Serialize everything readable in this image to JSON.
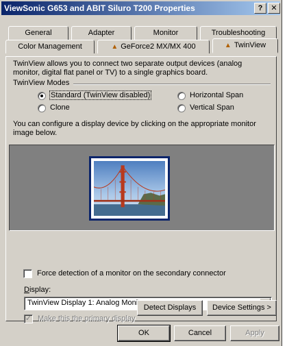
{
  "window": {
    "title": "ViewSonic G653 and ABIT Siluro T200 Properties",
    "help_btn": "?",
    "close_btn": "✕"
  },
  "tabs": {
    "row1": [
      "General",
      "Adapter",
      "Monitor",
      "Troubleshooting"
    ],
    "row2": [
      "Color Management",
      "GeForce2 MX/MX 400",
      "TwinView"
    ],
    "active": "TwinView"
  },
  "twinview": {
    "intro": "TwinView allows you to connect two separate output devices (analog monitor, digital flat panel or TV) to a single graphics board.",
    "modes_label": "TwinView Modes",
    "modes": [
      {
        "label": "Standard (TwinView disabled)",
        "checked": true
      },
      {
        "label": "Horizontal Span",
        "checked": false
      },
      {
        "label": "Clone",
        "checked": false
      },
      {
        "label": "Vertical Span",
        "checked": false
      }
    ],
    "configure_text": "You can configure a display device by clicking on the appropriate monitor image below.",
    "display_label": "Display:",
    "display_value": "TwinView Display 1: Analog Monitor",
    "primary_checkbox": "Make this the primary display",
    "force_checkbox": "Force detection of a monitor on the secondary connector",
    "detect_btn": "Detect Displays",
    "settings_btn": "Device Settings >"
  },
  "dialog_buttons": {
    "ok": "OK",
    "cancel": "Cancel",
    "apply": "Apply"
  }
}
